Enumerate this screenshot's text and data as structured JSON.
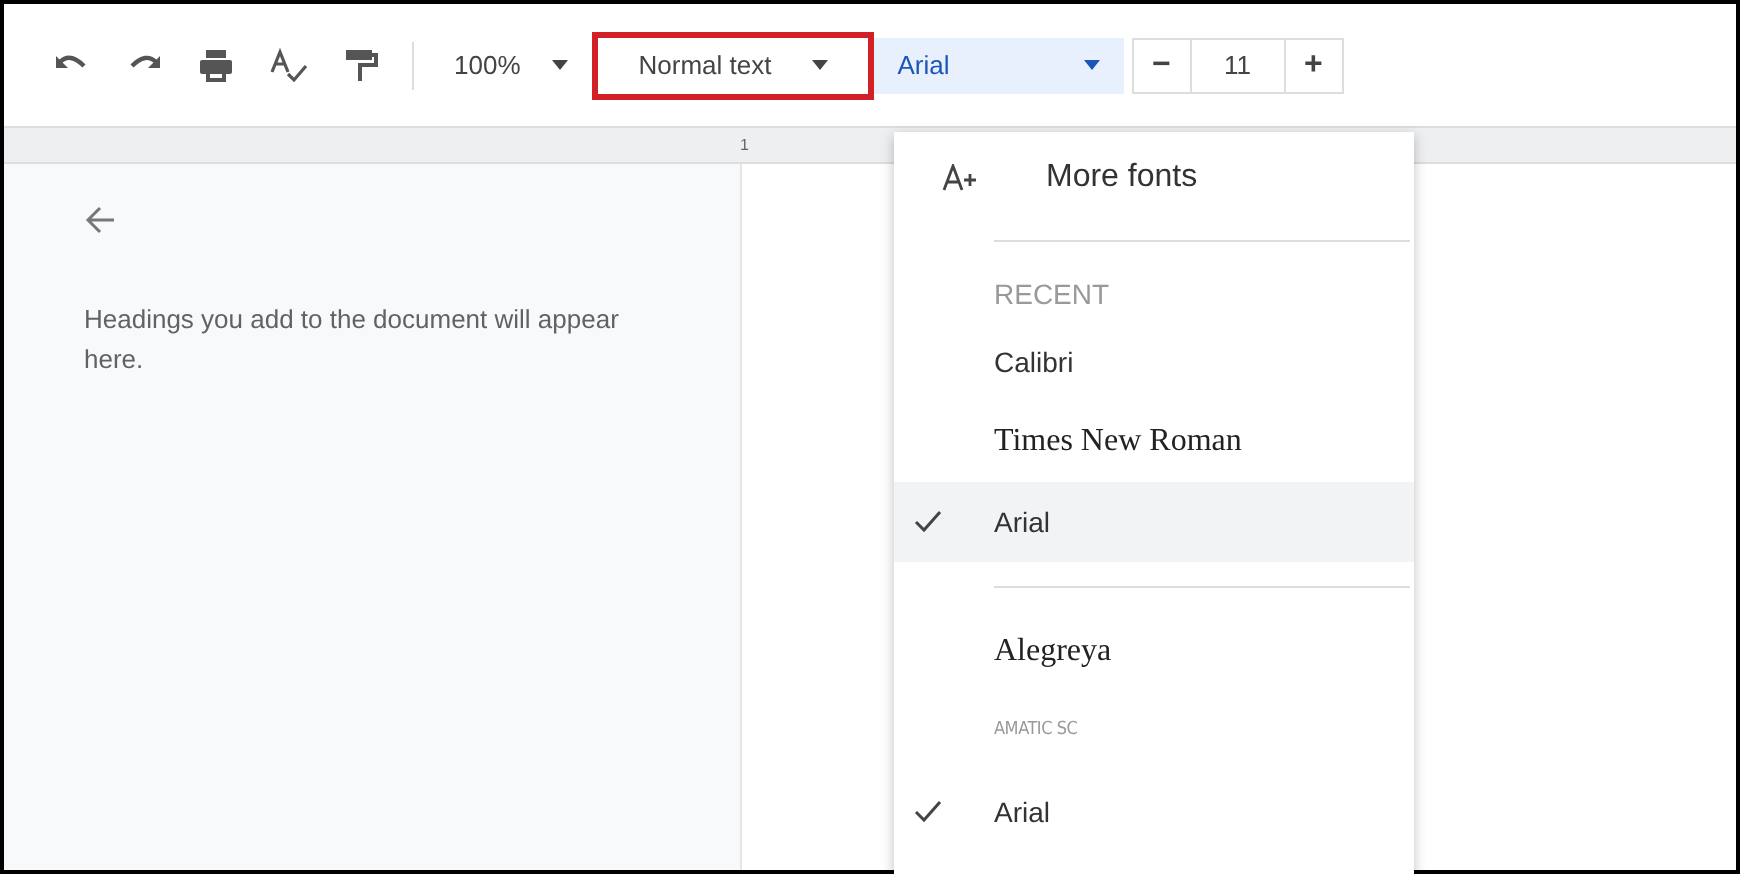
{
  "toolbar": {
    "zoom": "100%",
    "style": {
      "label": "Normal text",
      "highlighted": true
    },
    "font": "Arial",
    "size": {
      "minus": "−",
      "value": "11",
      "plus": "+"
    }
  },
  "ruler": {
    "mark": "1"
  },
  "outline": {
    "message": "Headings you add to the document will appear here."
  },
  "font_menu": {
    "more_fonts": "More fonts",
    "section": "RECENT",
    "recent": [
      {
        "label": "Calibri",
        "kind": "sans",
        "checked": false,
        "selected": false
      },
      {
        "label": "Times New Roman",
        "kind": "serif",
        "checked": false,
        "selected": false
      },
      {
        "label": "Arial",
        "kind": "sans",
        "checked": true,
        "selected": true
      }
    ],
    "fonts": [
      {
        "label": "Alegreya",
        "kind": "serif",
        "checked": false,
        "selected": false
      },
      {
        "label": "AMATIC SC",
        "kind": "display",
        "checked": false,
        "selected": false
      },
      {
        "label": "Arial",
        "kind": "sans",
        "checked": true,
        "selected": false
      }
    ]
  }
}
